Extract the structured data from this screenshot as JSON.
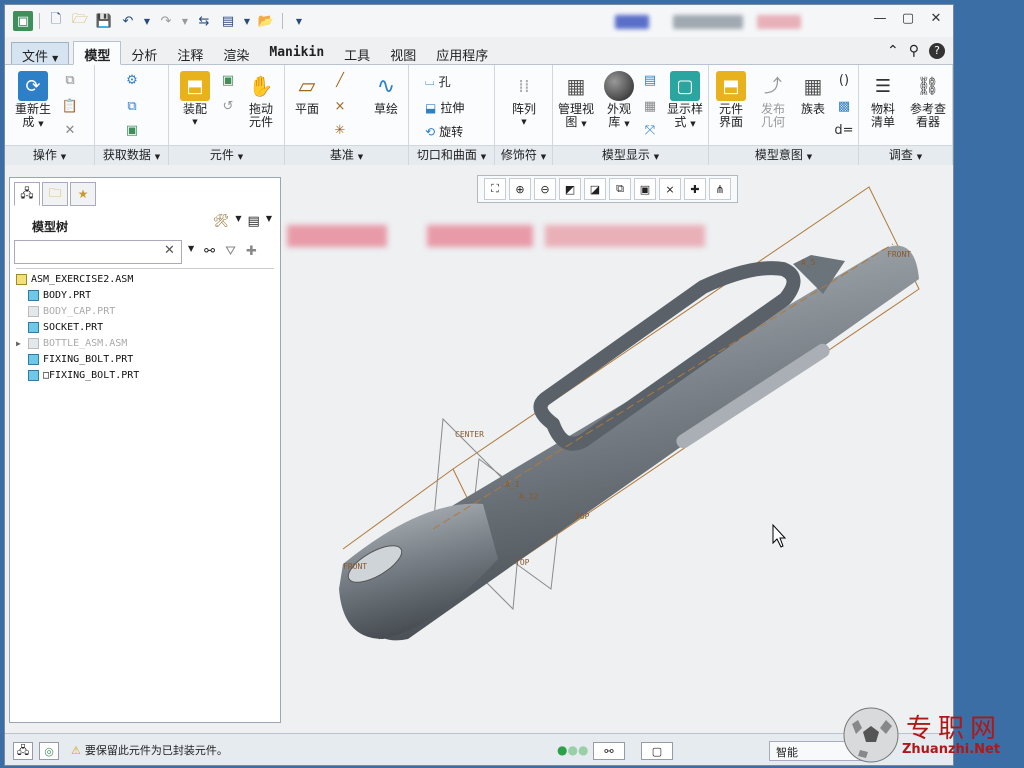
{
  "tabs": {
    "file": "文件",
    "model": "模型",
    "analysis": "分析",
    "annotate": "注释",
    "render": "渲染",
    "manikin": "Manikin",
    "tools": "工具",
    "view": "视图",
    "apps": "应用程序"
  },
  "ribbon": {
    "operations": {
      "label": "操作",
      "regenerate": "重新生",
      "regenerate2": "成"
    },
    "getdata": {
      "label": "获取数据"
    },
    "component": {
      "label": "元件",
      "assemble": "装配",
      "drag": "拖动",
      "drag2": "元件"
    },
    "datum": {
      "label": "基准",
      "plane": "平面",
      "sketch": "草绘"
    },
    "cut": {
      "label": "切口和曲面",
      "hole": "孔",
      "extrude": "拉伸",
      "revolve": "旋转"
    },
    "modifiers": {
      "label": "修饰符",
      "pattern": "阵列"
    },
    "display": {
      "label": "模型显示",
      "manage_view": "管理视",
      "manage_view2": "图",
      "appearance": "外观",
      "appearance2": "库",
      "display_style": "显示样",
      "display_style2": "式"
    },
    "intent": {
      "label": "模型意图",
      "component_interface": "元件",
      "component_interface2": "界面",
      "publish_geom": "发布",
      "publish_geom2": "几何",
      "family_table": "族表"
    },
    "investigate": {
      "label": "调查",
      "bom": "物料",
      "bom2": "清单",
      "ref_viewer": "参考查",
      "ref_viewer2": "看器"
    }
  },
  "panel": {
    "title": "模型树",
    "search_value": "",
    "tree": [
      {
        "name": "ASM_EXERCISE2.ASM",
        "type": "asm",
        "dim": false,
        "expander": ""
      },
      {
        "name": "BODY.PRT",
        "type": "prt",
        "dim": false,
        "expander": ""
      },
      {
        "name": "BODY_CAP.PRT",
        "type": "prt",
        "dim": true,
        "expander": ""
      },
      {
        "name": "SOCKET.PRT",
        "type": "prt",
        "dim": false,
        "expander": ""
      },
      {
        "name": "BOTTLE_ASM.ASM",
        "type": "asm",
        "dim": true,
        "expander": "▶"
      },
      {
        "name": "FIXING_BOLT.PRT",
        "type": "prt",
        "dim": false,
        "expander": ""
      },
      {
        "name": "□FIXING_BOLT.PRT",
        "type": "prt",
        "dim": false,
        "expander": ""
      }
    ]
  },
  "canvas": {
    "labels": {
      "front1": "FRONT",
      "center": "CENTER",
      "top1": "TOP",
      "top2": "TOP",
      "front2": "FRONT",
      "a5": "A_5",
      "a1": "A_1",
      "a12": "A_12"
    }
  },
  "status": {
    "message": "要保留此元件为已封装元件。",
    "filter": "智能"
  },
  "watermark": {
    "cn": "专职网",
    "en": "Zhuanzhi.Net"
  },
  "colors": {
    "accent": "#3a6ea5",
    "model": "#6b737b",
    "datum": "#b07a3a"
  }
}
